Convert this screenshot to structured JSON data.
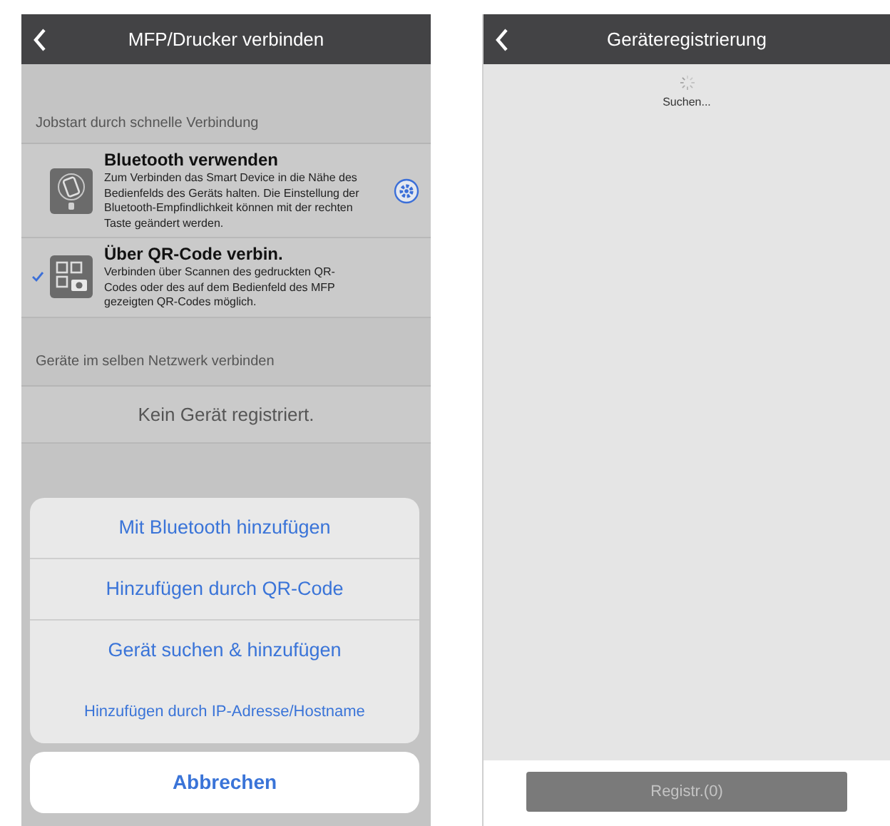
{
  "left_screen": {
    "title": "MFP/Drucker verbinden",
    "section_1": "Jobstart durch schnelle Verbindung",
    "methods": [
      {
        "kind": "bluetooth",
        "title": "Bluetooth verwenden",
        "description": "Zum Verbinden das Smart Device in die Nähe des Bedienfelds des Geräts halten. Die Einstellung der Bluetooth-Empfindlichkeit können mit der rechten Taste geändert werden.",
        "selected": false,
        "has_settings": true
      },
      {
        "kind": "qr",
        "title": "Über QR-Code verbin.",
        "description": "Verbinden über Scannen des gedruckten QR-Codes oder des auf dem Bedienfeld des MFP gezeigten QR-Codes möglich.",
        "selected": true,
        "has_settings": false
      }
    ],
    "section_2": "Geräte im selben Netzwerk verbinden",
    "empty_message": "Kein Gerät registriert.",
    "action_sheet": {
      "options": [
        "Mit Bluetooth hinzufügen",
        "Hinzufügen durch QR-Code",
        "Gerät suchen & hinzufügen",
        "Hinzufügen durch IP-Adresse/Hostname"
      ],
      "cancel": "Abbrechen"
    }
  },
  "right_screen": {
    "title": "Geräteregistrierung",
    "status": "Suchen...",
    "register_button": {
      "label": "Registr.(0)",
      "disabled": true
    }
  }
}
